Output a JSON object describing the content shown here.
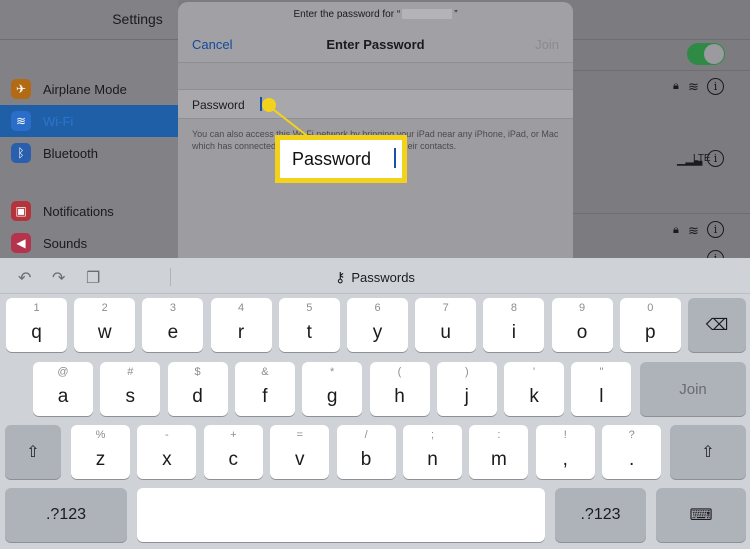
{
  "settings": {
    "title": "Settings",
    "rows": [
      {
        "label": "Airplane Mode",
        "color": "#d9831a",
        "icon": "airplane-icon",
        "glyph": "✈"
      },
      {
        "label": "Wi-Fi",
        "color": "#2a6ec9",
        "icon": "wifi-icon",
        "glyph": "≋"
      },
      {
        "label": "Bluetooth",
        "color": "#2a6ec9",
        "icon": "bluetooth-icon",
        "glyph": "ʙ"
      },
      {
        "label": "Notifications",
        "color": "#d33a3a",
        "icon": "notifications-icon",
        "glyph": "▣"
      },
      {
        "label": "Sounds",
        "color": "#d33a57",
        "icon": "sounds-icon",
        "glyph": "◀"
      }
    ],
    "cellular_indicator": "LTE"
  },
  "modal": {
    "subtitle_before": "Enter the password for “",
    "subtitle_after": "”",
    "cancel": "Cancel",
    "title": "Enter Password",
    "join": "Join",
    "field_label": "Password",
    "note": "You can also access this Wi-Fi network by bringing your iPad near any iPhone, iPad, or Mac which has connected to this network and has you in their contacts."
  },
  "callout": {
    "text": "Password"
  },
  "keyboard": {
    "undo_icon": "undo-icon",
    "redo_icon": "redo-icon",
    "paste_icon": "paste-icon",
    "passwords_label": "Passwords",
    "row1": [
      {
        "hint": "1",
        "key": "q"
      },
      {
        "hint": "2",
        "key": "w"
      },
      {
        "hint": "3",
        "key": "e"
      },
      {
        "hint": "4",
        "key": "r"
      },
      {
        "hint": "5",
        "key": "t"
      },
      {
        "hint": "6",
        "key": "y"
      },
      {
        "hint": "7",
        "key": "u"
      },
      {
        "hint": "8",
        "key": "i"
      },
      {
        "hint": "9",
        "key": "o"
      },
      {
        "hint": "0",
        "key": "p"
      }
    ],
    "row2": [
      {
        "hint": "@",
        "key": "a"
      },
      {
        "hint": "#",
        "key": "s"
      },
      {
        "hint": "$",
        "key": "d"
      },
      {
        "hint": "&",
        "key": "f"
      },
      {
        "hint": "*",
        "key": "g"
      },
      {
        "hint": "(",
        "key": "h"
      },
      {
        "hint": ")",
        "key": "j"
      },
      {
        "hint": "'",
        "key": "k"
      },
      {
        "hint": "\"",
        "key": "l"
      }
    ],
    "row3": [
      {
        "hint": "%",
        "key": "z"
      },
      {
        "hint": "-",
        "key": "x"
      },
      {
        "hint": "+",
        "key": "c"
      },
      {
        "hint": "=",
        "key": "v"
      },
      {
        "hint": "/",
        "key": "b"
      },
      {
        "hint": ";",
        "key": "n"
      },
      {
        "hint": ":",
        "key": "m"
      },
      {
        "hint": "!",
        "key": ","
      },
      {
        "hint": "?",
        "key": "."
      }
    ],
    "join_label": "Join",
    "numbers_label": ".?123"
  }
}
